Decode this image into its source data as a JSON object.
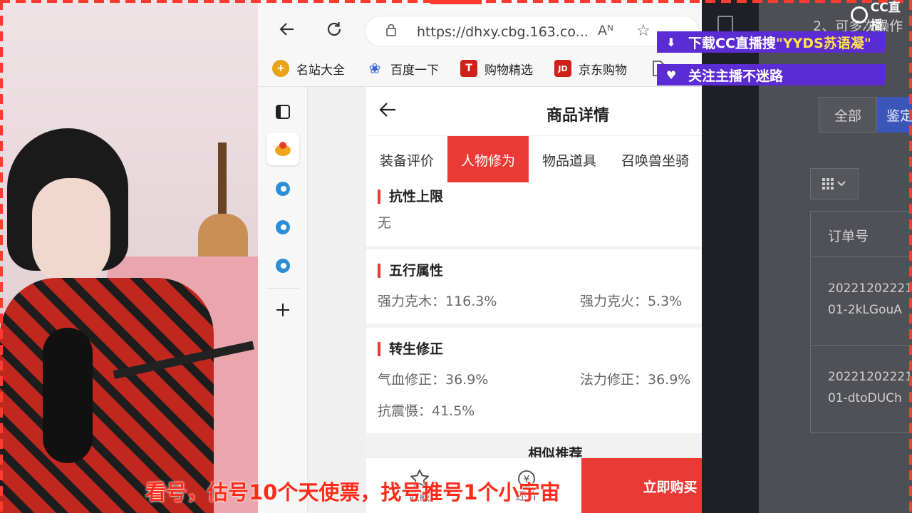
{
  "browser": {
    "url": "https://dhxy.cbg.163.co...",
    "read_aloud_glyph": "A",
    "bookmarks": [
      {
        "label": "名站大全",
        "icon": "plus-globe-icon",
        "color": "#e8a317"
      },
      {
        "label": "百度一下",
        "icon": "baidu-paw-icon",
        "color": "#3c66e0"
      },
      {
        "label": "购物精选",
        "icon": "shopping-t-icon",
        "color": "#d0201a",
        "glyph": "T"
      },
      {
        "label": "京东购物",
        "icon": "jd-icon",
        "color": "#d0201a",
        "glyph": "JD"
      }
    ],
    "sidebar_icons": [
      "tabs-icon",
      "game-icon",
      "edge-icon",
      "edge-icon",
      "edge-icon",
      "add-icon"
    ]
  },
  "page": {
    "title": "商品详情",
    "tabs": [
      {
        "label": "装备评价",
        "active": false
      },
      {
        "label": "人物修为",
        "active": true
      },
      {
        "label": "物品道具",
        "active": false
      },
      {
        "label": "召唤兽坐骑",
        "active": false
      }
    ],
    "resist_cap": {
      "title": "抗性上限",
      "value": "无"
    },
    "five_elements": {
      "title": "五行属性",
      "items": [
        "强力克木：116.3%",
        "强力克火：5.3%"
      ]
    },
    "rebirth": {
      "title": "转生修正",
      "items": [
        "气血修正：36.9%",
        "法力修正：36.9%",
        "抗震慑：41.5%"
      ]
    },
    "similar_label": "相似推荐",
    "bottom": {
      "collect_label": "收藏",
      "price_label": "还价",
      "buy_label": "立即购买"
    }
  },
  "right_panel": {
    "note_line": "2、可多次操作",
    "filter_all": "全部",
    "filter_second": "鉴定",
    "table_header": "订单号",
    "rows": [
      {
        "line1": "20221202221",
        "line2": "01-2kLGouA"
      },
      {
        "line1": "20221202221",
        "line2": "01-dtoDUCh"
      }
    ]
  },
  "overlay": {
    "cc_logo": "CC直播",
    "banner1_prefix": "下载CC直播搜",
    "banner1_highlight": "\"YYDS苏语凝\"",
    "banner2": "关注主播不迷路",
    "subtitle": "看号，估号10个天使票，找号推号1个小宇宙"
  }
}
